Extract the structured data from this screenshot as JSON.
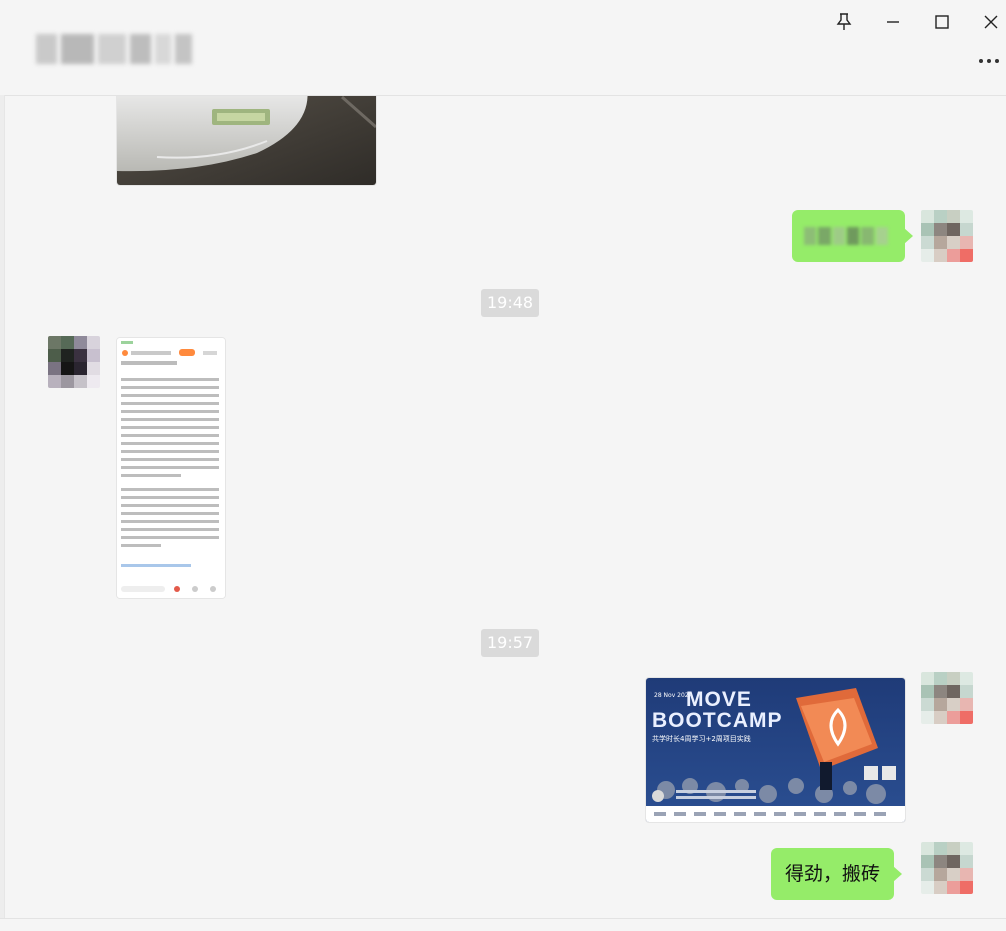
{
  "window": {
    "title_redacted": true,
    "pin_icon": "pin-icon",
    "minimize_icon": "minimize-icon",
    "maximize_icon": "maximize-icon",
    "close_icon": "close-icon",
    "more_icon": "more-icon"
  },
  "messages": [
    {
      "type": "image",
      "sender": "other",
      "content": "car-front-photo"
    },
    {
      "type": "text",
      "sender": "self",
      "redacted": true
    },
    {
      "type": "time",
      "text": "19:48"
    },
    {
      "type": "image",
      "sender": "other",
      "content": "article-screenshot"
    },
    {
      "type": "time",
      "text": "19:57"
    },
    {
      "type": "image",
      "sender": "self",
      "content": "event-poster",
      "poster": {
        "date": "28 Nov 2024",
        "title_line1": "MOVE",
        "title_line2": "BOOTCAMP",
        "subtitle": "共学时长4周学习+2周项目实践"
      }
    },
    {
      "type": "text",
      "sender": "self",
      "text": "得劲，搬砖"
    }
  ],
  "colors": {
    "background": "#f5f5f5",
    "self_bubble": "#95ec69",
    "time_badge": "#dadada"
  }
}
